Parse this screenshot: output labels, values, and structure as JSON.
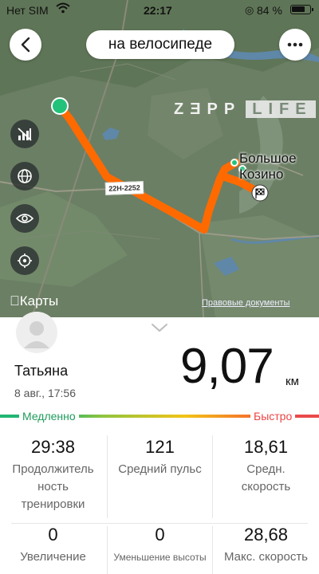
{
  "status_bar": {
    "carrier": "Нет SIM",
    "time": "22:17",
    "battery_percent": "84 %",
    "battery_level": 0.84
  },
  "header": {
    "title": "на велосипеде"
  },
  "map": {
    "logo_left": "ZƎPP",
    "logo_right": "LIFE",
    "place_line1": "Большое",
    "place_line2": "Козино",
    "maps_brand": "Карты",
    "legal_link": "Правовые документы",
    "road_badge": "22Н-2252",
    "route_color": "#ff6a00",
    "start_color": "#22c27a",
    "background_color": "#677c60"
  },
  "summary": {
    "user_name": "Татьяна",
    "date": "8 авг., 17:56",
    "distance": "9,07",
    "distance_unit": "км"
  },
  "pace_scale": {
    "slow_label": "Медленно",
    "fast_label": "Быстро",
    "slow_color": "#22b573",
    "fast_color": "#ea4a4a"
  },
  "stats": [
    {
      "value": "29:38",
      "label_lines": [
        "Продолжитель",
        "ность",
        "тренировки"
      ]
    },
    {
      "value": "121",
      "label_lines": [
        "Средний пульс"
      ]
    },
    {
      "value": "18,61",
      "label_lines": [
        "Средн.",
        "скорость"
      ]
    },
    {
      "value": "0",
      "label_lines": [
        "Увеличение"
      ]
    },
    {
      "value": "0",
      "label_lines": [
        "Уменьшение высоты"
      ]
    },
    {
      "value": "28,68",
      "label_lines": [
        "Макс. скорость"
      ]
    }
  ]
}
